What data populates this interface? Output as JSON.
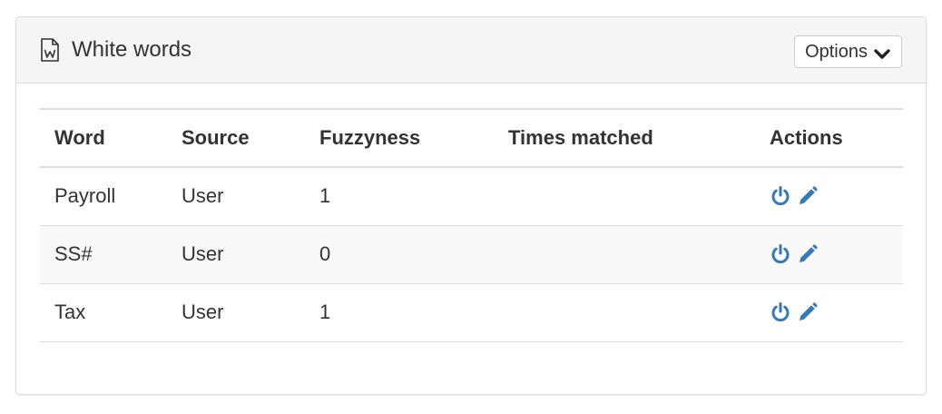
{
  "panel": {
    "title": "White words",
    "title_icon": "word-document-icon",
    "options_label": "Options",
    "options_icon": "chevron-down-icon"
  },
  "table": {
    "columns": [
      "Word",
      "Source",
      "Fuzzyness",
      "Times matched",
      "Actions"
    ],
    "rows": [
      {
        "word": "Payroll",
        "source": "User",
        "fuzzyness": "1",
        "times_matched": "",
        "actions": [
          "power-icon",
          "pencil-icon"
        ]
      },
      {
        "word": "SS#",
        "source": "User",
        "fuzzyness": "0",
        "times_matched": "",
        "actions": [
          "power-icon",
          "pencil-icon"
        ]
      },
      {
        "word": "Tax",
        "source": "User",
        "fuzzyness": "1",
        "times_matched": "",
        "actions": [
          "power-icon",
          "pencil-icon"
        ]
      }
    ]
  },
  "colors": {
    "action_icon": "#337ab7",
    "heading_bg": "#f5f5f5",
    "border": "#dddddd"
  }
}
